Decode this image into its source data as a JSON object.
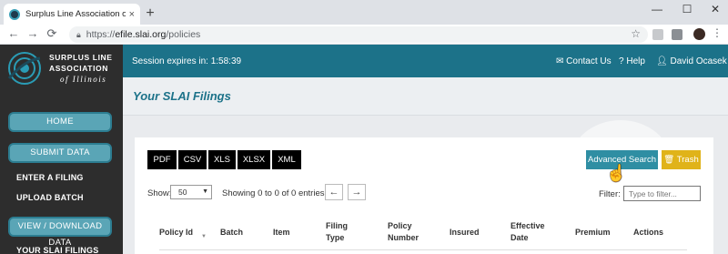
{
  "browser": {
    "tab_title": "Surplus Line Association of Illinois",
    "tab_close": "×",
    "new_tab": "+",
    "url_scheme": "https://",
    "url_host": "efile.slai.org",
    "url_path": "/policies",
    "window_controls": [
      "—",
      "☐",
      "✕"
    ]
  },
  "logo": {
    "line1": "SURPLUS LINE",
    "line2": "ASSOCIATION",
    "line3": "of Illinois"
  },
  "header": {
    "session_text": "Session expires in: 1:58:39",
    "contact_us": "Contact Us",
    "help": "Help",
    "user": "David Ocasek"
  },
  "sidebar": {
    "home": "HOME",
    "submit_data": "SUBMIT DATA",
    "enter_filing": "ENTER A FILING",
    "upload_batch": "UPLOAD BATCH",
    "view_download": "VIEW / DOWNLOAD DATA",
    "your_filings": "YOUR SLAI FILINGS"
  },
  "main": {
    "title": "Your SLAI Filings",
    "export_buttons": [
      "PDF",
      "CSV",
      "XLS",
      "XLSX",
      "XML"
    ],
    "advanced_search": "Advanced Search",
    "trash": "Trash",
    "show_label": "Show:",
    "page_size": "50",
    "entries_text": "Showing 0 to 0 of 0 entries",
    "prev": "←",
    "next": "→",
    "filter_label": "Filter:",
    "filter_placeholder": "Type to filter...",
    "columns": [
      "Policy Id",
      "Batch",
      "Item",
      "Filing Type",
      "Policy Number",
      "Insured",
      "Effective Date",
      "Premium",
      "Actions"
    ]
  },
  "colors": {
    "header_teal": "#1c7289",
    "sidebar_dark": "#2d2d2d",
    "button_teal": "#2f8ea3",
    "trash_yellow": "#e0b319"
  }
}
